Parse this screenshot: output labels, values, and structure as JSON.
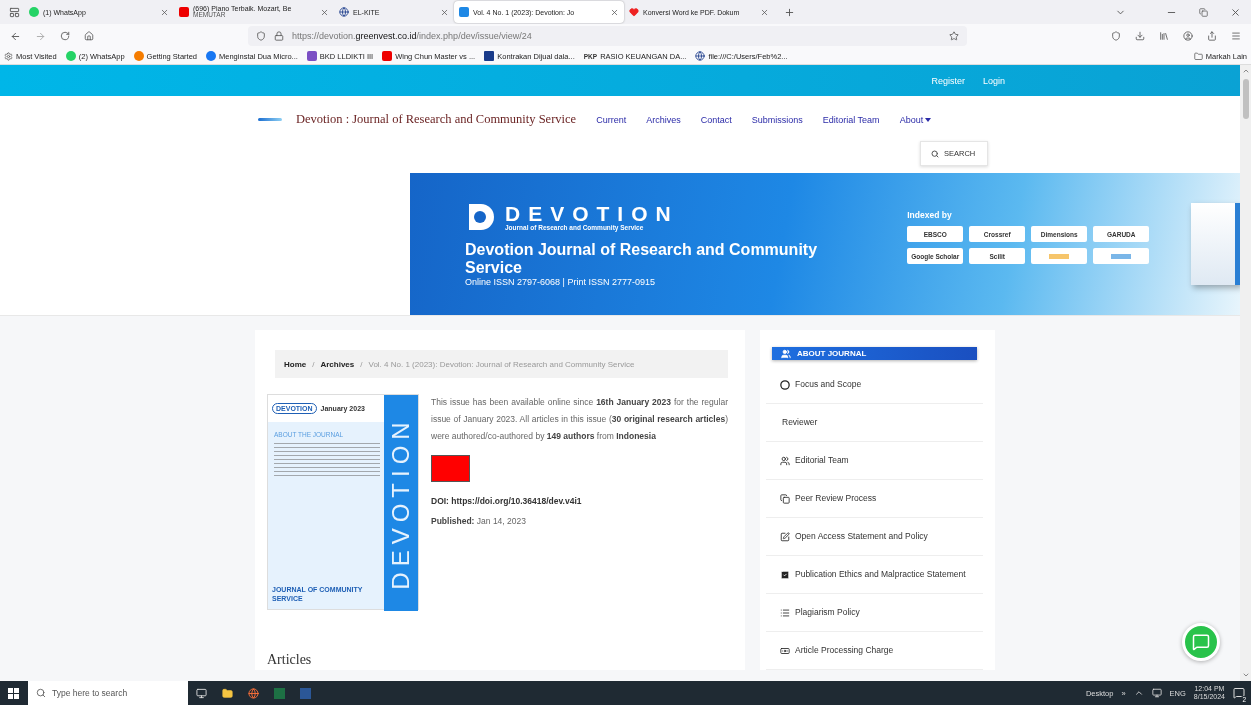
{
  "browser": {
    "tabs": [
      {
        "title": "(1) WhatsApp",
        "kind": "chat",
        "selected": false
      },
      {
        "title": "(696) Piano Terbaik. Mozart, Be",
        "subtitle": "MEMUTAR",
        "kind": "video",
        "selected": false
      },
      {
        "title": "EL-KITE",
        "kind": "globe",
        "selected": false
      },
      {
        "title": "Vol. 4 No. 1 (2023): Devotion: Jo",
        "kind": "letter",
        "selected": true
      },
      {
        "title": "Konversi Word ke PDF. Dokum",
        "kind": "heart",
        "selected": false
      }
    ],
    "url": {
      "prefix": "https://devotion.",
      "domain": "greenvest.co.id",
      "path": "/index.php/dev/issue/view/24"
    },
    "bookmarks": [
      {
        "label": "Most Visited",
        "kind": "gear"
      },
      {
        "label": "(2) WhatsApp",
        "kind": "chat"
      },
      {
        "label": "Getting Started",
        "kind": "flame"
      },
      {
        "label": "Menginstal Dua Micro...",
        "kind": "fb"
      },
      {
        "label": "BKD LLDIKTI III",
        "kind": "cap"
      },
      {
        "label": "Wing Chun Master vs ...",
        "kind": "video"
      },
      {
        "label": "Kontrakan Dijual dala...",
        "kind": "square"
      },
      {
        "label": "RASIO KEUANGAN DA...",
        "kind": "text",
        "badge": "PKP"
      },
      {
        "label": "file:///C:/Users/Feb%2...",
        "kind": "globe"
      }
    ],
    "other_bookmarks": "Markah Lain"
  },
  "site": {
    "top_links": [
      "Register",
      "Login"
    ],
    "title": "Devotion : Journal of Research and Community Service",
    "nav": [
      {
        "label": "Current",
        "dropdown": false
      },
      {
        "label": "Archives",
        "dropdown": false
      },
      {
        "label": "Contact",
        "dropdown": false
      },
      {
        "label": "Submissions",
        "dropdown": false
      },
      {
        "label": "Editorial Team",
        "dropdown": false
      },
      {
        "label": "About",
        "dropdown": true
      }
    ],
    "search": "SEARCH",
    "banner": {
      "logo": "DEVOTION",
      "logo_tagline": "Journal of Research and Community Service",
      "title": "Devotion Journal of Research and Community Service",
      "issn": "Online ISSN 2797-6068 | Print ISSN 2777-0915",
      "indexed_heading": "Indexed by",
      "indexes": [
        "EBSCO",
        "Crossref",
        "Dimensions",
        "GARUDA",
        "Google Scholar",
        "Scilit"
      ]
    },
    "breadcrumb_separator": "/",
    "breadcrumb": [
      {
        "label": "Home",
        "current": false
      },
      {
        "label": "Archives",
        "current": false
      },
      {
        "label": "Vol. 4 No. 1 (2023): Devotion: Journal of Research and Community Service",
        "current": true
      }
    ],
    "cover": {
      "logo": "DEVOTION",
      "issue": "January 2023",
      "about": "ABOUT THE JOURNAL",
      "vertical": "DEVOTION",
      "footer": "JOURNAL OF COMMUNITY SERVICE"
    },
    "issue": {
      "description": "This issue has been available online since **16th January 2023** for the regular issue of January 2023. All articles in this issue (**30 original research articles**) were authored/co-authored by **149 authors** from **Indonesia**",
      "doi": "DOI: https://doi.org/10.36418/dev.v4i1",
      "published_label": "Published:",
      "published_value": "Jan 14, 2023"
    },
    "articles_heading": "Articles",
    "sidebar": {
      "heading": "ABOUT JOURNAL",
      "items": [
        {
          "label": "Focus and Scope",
          "kind": "circle"
        },
        {
          "label": "Reviewer",
          "kind": "none"
        },
        {
          "label": "Editorial Team",
          "kind": "users"
        },
        {
          "label": "Peer Review Process",
          "kind": "copy"
        },
        {
          "label": "Open Access Statement and Policy",
          "kind": "edit"
        },
        {
          "label": "Publication Ethics and Malpractice Statement",
          "kind": "pen-square"
        },
        {
          "label": "Plagiarism Policy",
          "kind": "list"
        },
        {
          "label": "Article Processing Charge",
          "kind": "money"
        }
      ]
    }
  },
  "taskbar": {
    "search_placeholder": "Type here to search",
    "desktop": "Desktop",
    "overflow": "»",
    "language": "ENG",
    "time": "12:04 PM",
    "date": "8/15/2024",
    "notifications": "2"
  }
}
